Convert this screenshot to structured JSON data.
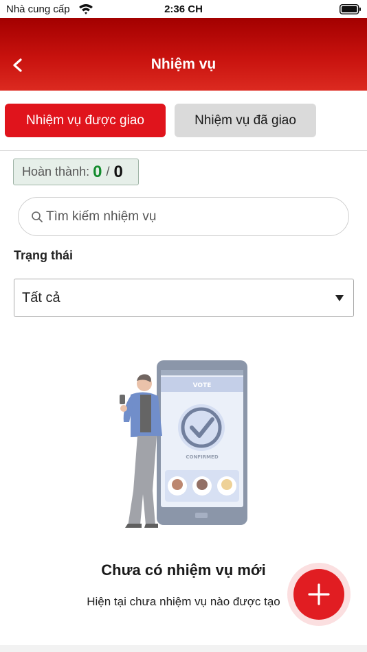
{
  "status_bar": {
    "carrier": "Nhà cung cấp",
    "time": "2:36 CH",
    "icons": [
      "wifi-icon",
      "battery-icon"
    ]
  },
  "header": {
    "title": "Nhiệm vụ",
    "back_icon": "chevron-left-icon",
    "gradient_colors": [
      "#a30000",
      "#dc2a20"
    ]
  },
  "tabs": [
    {
      "label": "Nhiệm vụ được giao",
      "active": true,
      "color": "#e0141c"
    },
    {
      "label": "Nhiệm vụ đã giao",
      "active": false,
      "color": "#dadada"
    }
  ],
  "completion": {
    "label": "Hoàn thành:",
    "done": "0",
    "separator": "/",
    "total": "0",
    "done_color": "#148c2e"
  },
  "search": {
    "placeholder": "Tìm kiếm nhiệm vụ",
    "value": ""
  },
  "filter": {
    "label": "Trạng thái",
    "selected": "Tất cả"
  },
  "illustration": {
    "vote_label": "VOTE",
    "confirmed_label": "CONFIRMED"
  },
  "empty_state": {
    "title": "Chưa có nhiệm vụ mới",
    "subtitle": "Hiện tại chưa nhiệm vụ nào được tạo"
  },
  "fab": {
    "icon": "plus-icon",
    "color": "#e11d22"
  }
}
